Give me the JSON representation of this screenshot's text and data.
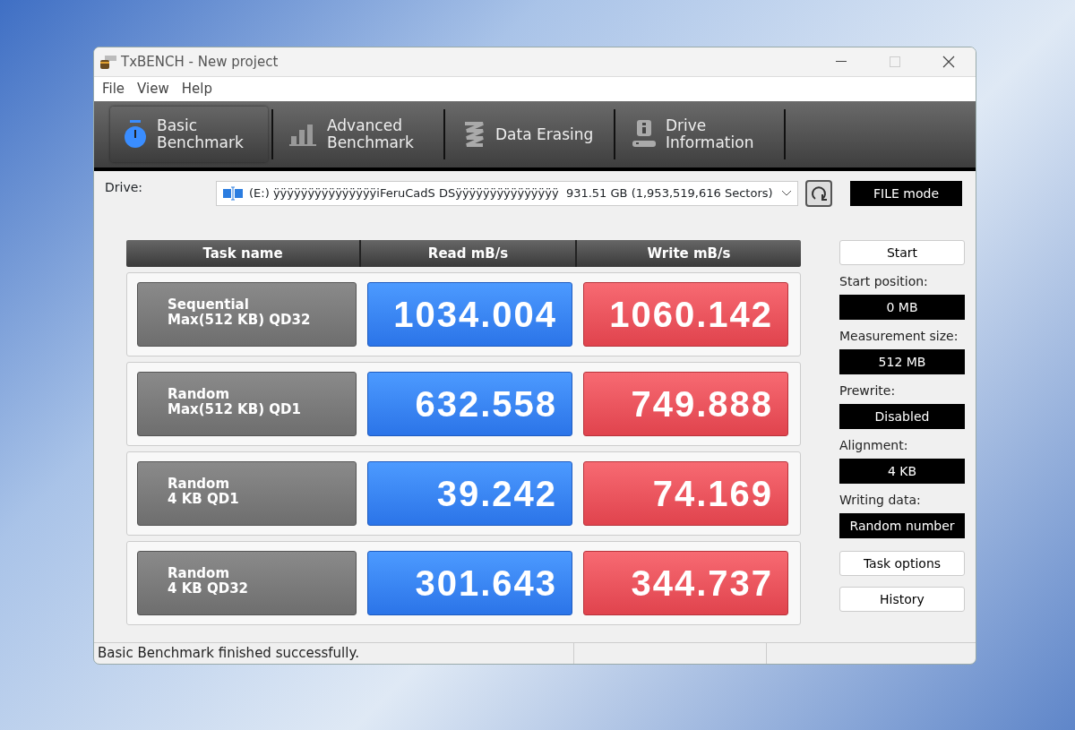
{
  "window": {
    "title": "TxBENCH - New project"
  },
  "menu": [
    "File",
    "View",
    "Help"
  ],
  "tabs": [
    {
      "kind": "stopwatch",
      "lines": [
        "Basic",
        "Benchmark"
      ],
      "selected": true
    },
    {
      "kind": "bars",
      "lines": [
        "Advanced",
        "Benchmark"
      ],
      "selected": false
    },
    {
      "kind": "eraser",
      "lines": [
        "Data Erasing"
      ],
      "selected": false
    },
    {
      "kind": "info",
      "lines": [
        "Drive",
        "Information"
      ],
      "selected": false
    }
  ],
  "drive": {
    "label": "Drive:",
    "value": "(E:) ÿÿÿÿÿÿÿÿÿÿÿÿÿÿÿiFeruCadS DSÿÿÿÿÿÿÿÿÿÿÿÿÿÿÿ  931.51 GB (1,953,519,616 Sectors)"
  },
  "mode": "FILE mode",
  "table": {
    "columns": [
      "Task name",
      "Read mB/s",
      "Write mB/s"
    ],
    "rows": [
      {
        "task": [
          "Sequential",
          "Max(512 KB) QD32"
        ],
        "read": "1034.004",
        "write": "1060.142"
      },
      {
        "task": [
          "Random",
          "Max(512 KB) QD1"
        ],
        "read": "632.558",
        "write": "749.888"
      },
      {
        "task": [
          "Random",
          "4 KB QD1"
        ],
        "read": "39.242",
        "write": "74.169"
      },
      {
        "task": [
          "Random",
          "4 KB QD32"
        ],
        "read": "301.643",
        "write": "344.737"
      }
    ]
  },
  "start_button": "Start",
  "settings": [
    {
      "label": "Start position:",
      "value": "0 MB"
    },
    {
      "label": "Measurement size:",
      "value": "512 MB"
    },
    {
      "label": "Prewrite:",
      "value": "Disabled"
    },
    {
      "label": "Alignment:",
      "value": "4 KB"
    },
    {
      "label": "Writing data:",
      "value": "Random number"
    }
  ],
  "buttons": [
    "Task options",
    "History"
  ],
  "status_bar": [
    "Basic Benchmark finished successfully."
  ]
}
